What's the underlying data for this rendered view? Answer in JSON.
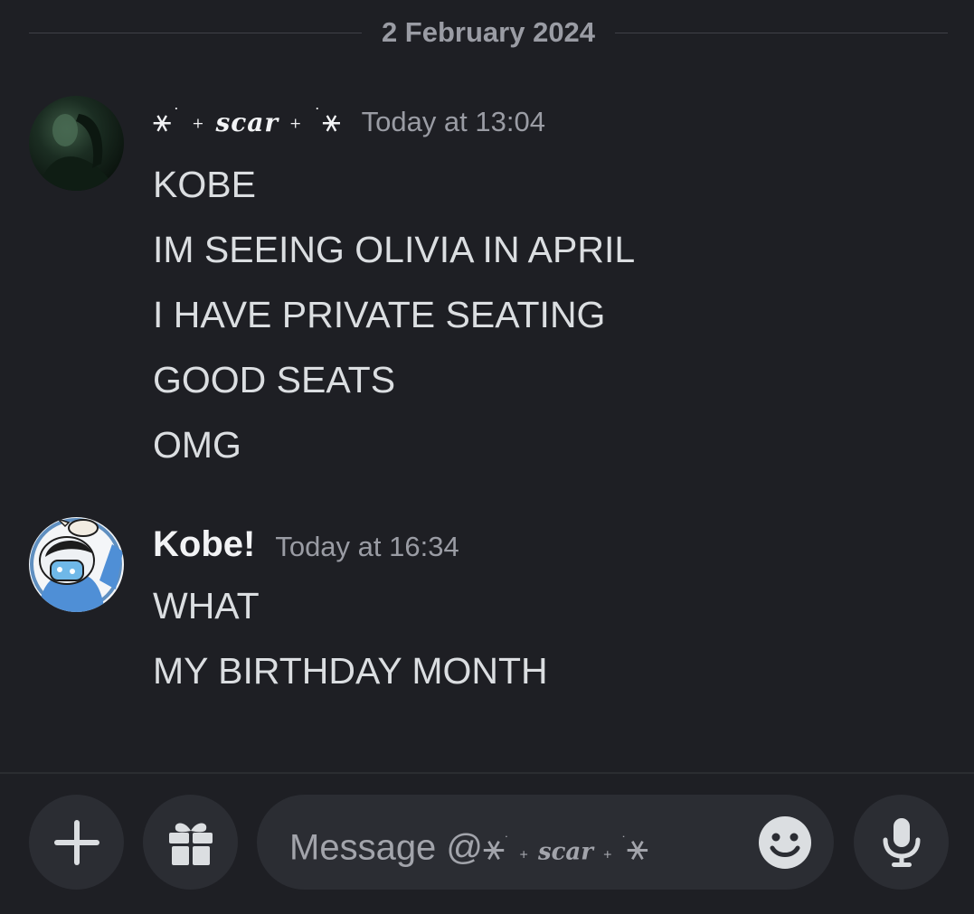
{
  "divider": {
    "date": "2 February 2024"
  },
  "messages": [
    {
      "author": {
        "star_left": "⚹",
        "dot_left": "˙",
        "sparkle_left": "+",
        "name": "scar",
        "sparkle_right": "+",
        "dot_right": "˙",
        "star_right": "⚹"
      },
      "timestamp": "Today at 13:04",
      "lines": [
        "KOBE",
        "IM SEEING OLIVIA IN APRIL",
        "I HAVE PRIVATE SEATING",
        "GOOD SEATS",
        "OMG"
      ]
    },
    {
      "author": {
        "name": "Kobe!"
      },
      "timestamp": "Today at 16:34",
      "lines": [
        "WHAT",
        "MY BIRTHDAY MONTH"
      ]
    }
  ],
  "composer": {
    "placeholder_prefix": "Message @",
    "recipient": {
      "star_left": "⚹",
      "dot_left": "˙",
      "sparkle_left": "+",
      "name": "scar",
      "sparkle_right": "+",
      "dot_right": "˙",
      "star_right": "⚹"
    },
    "icons": {
      "add": "plus-icon",
      "gift": "gift-icon",
      "emoji": "smiley-icon",
      "voice": "microphone-icon"
    }
  },
  "colors": {
    "background": "#1e1f24",
    "button_background": "#2b2d33",
    "text": "#dbdee1",
    "muted_text": "#9a9ca4",
    "icon": "#dbdee1"
  }
}
